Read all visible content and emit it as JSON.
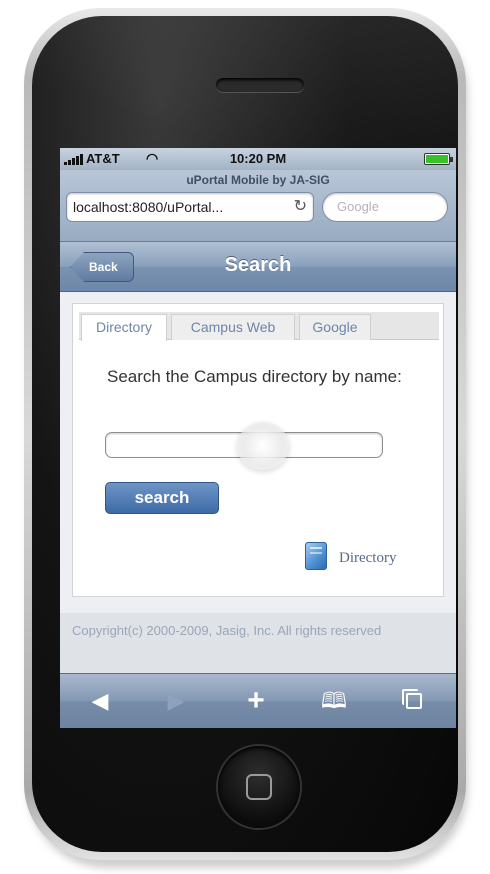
{
  "status_bar": {
    "carrier": "AT&T",
    "time": "10:20 PM"
  },
  "browser": {
    "page_title": "uPortal Mobile by JA-SIG",
    "url": "localhost:8080/uPortal...",
    "search_placeholder": "Google"
  },
  "nav": {
    "back_label": "Back",
    "title": "Search"
  },
  "tabs": [
    {
      "label": "Directory",
      "active": true
    },
    {
      "label": "Campus Web",
      "active": false
    },
    {
      "label": "Google",
      "active": false
    }
  ],
  "directory_search": {
    "prompt": "Search the Campus directory by name:",
    "input_value": "",
    "button_label": "search",
    "badge_label": "Directory"
  },
  "footer": {
    "text": "Copyright(c) 2000-2009, Jasig, Inc. All rights reserved"
  },
  "toolbar": {
    "icons": [
      "back-arrow-icon",
      "forward-arrow-icon",
      "add-icon",
      "bookmarks-icon",
      "pages-icon"
    ]
  },
  "colors": {
    "nav_bar": "#7b93b1",
    "accent_button": "#3d6aa5",
    "tab_text": "#6d86a6",
    "battery": "#39c12b"
  }
}
